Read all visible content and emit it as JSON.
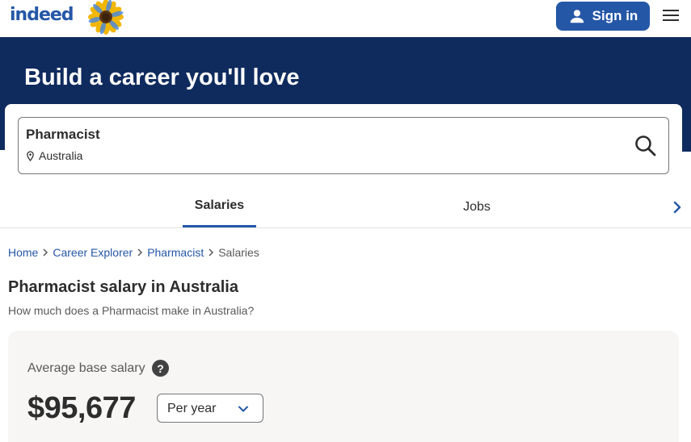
{
  "header": {
    "logo_text": "indeed",
    "signin_label": "Sign in"
  },
  "hero": {
    "title": "Build a career you'll love"
  },
  "search": {
    "what_value": "Pharmacist",
    "where_value": "Australia"
  },
  "tabs": [
    {
      "label": "Salaries",
      "active": true
    },
    {
      "label": "Jobs",
      "active": false
    }
  ],
  "breadcrumb": {
    "items": [
      {
        "label": "Home",
        "link": true
      },
      {
        "label": "Career Explorer",
        "link": true
      },
      {
        "label": "Pharmacist",
        "link": true
      },
      {
        "label": "Salaries",
        "link": false
      }
    ]
  },
  "main": {
    "title": "Pharmacist salary in Australia",
    "subtitle": "How much does a Pharmacist make in Australia?"
  },
  "salary": {
    "label": "Average base salary",
    "help_glyph": "?",
    "value": "$95,677",
    "period": "Per year"
  },
  "colors": {
    "brand_blue": "#2557a7",
    "hero_navy": "#0f2b5e",
    "card_bg": "#f7f6f5"
  },
  "icons": {
    "signin": "user-icon",
    "menu": "hamburger-menu-icon",
    "location": "map-pin-icon",
    "search": "search-icon",
    "tabs_next": "chevron-right-icon",
    "breadcrumb_sep": "chevron-right-icon",
    "help": "question-mark-icon",
    "period": "chevron-down-icon"
  }
}
